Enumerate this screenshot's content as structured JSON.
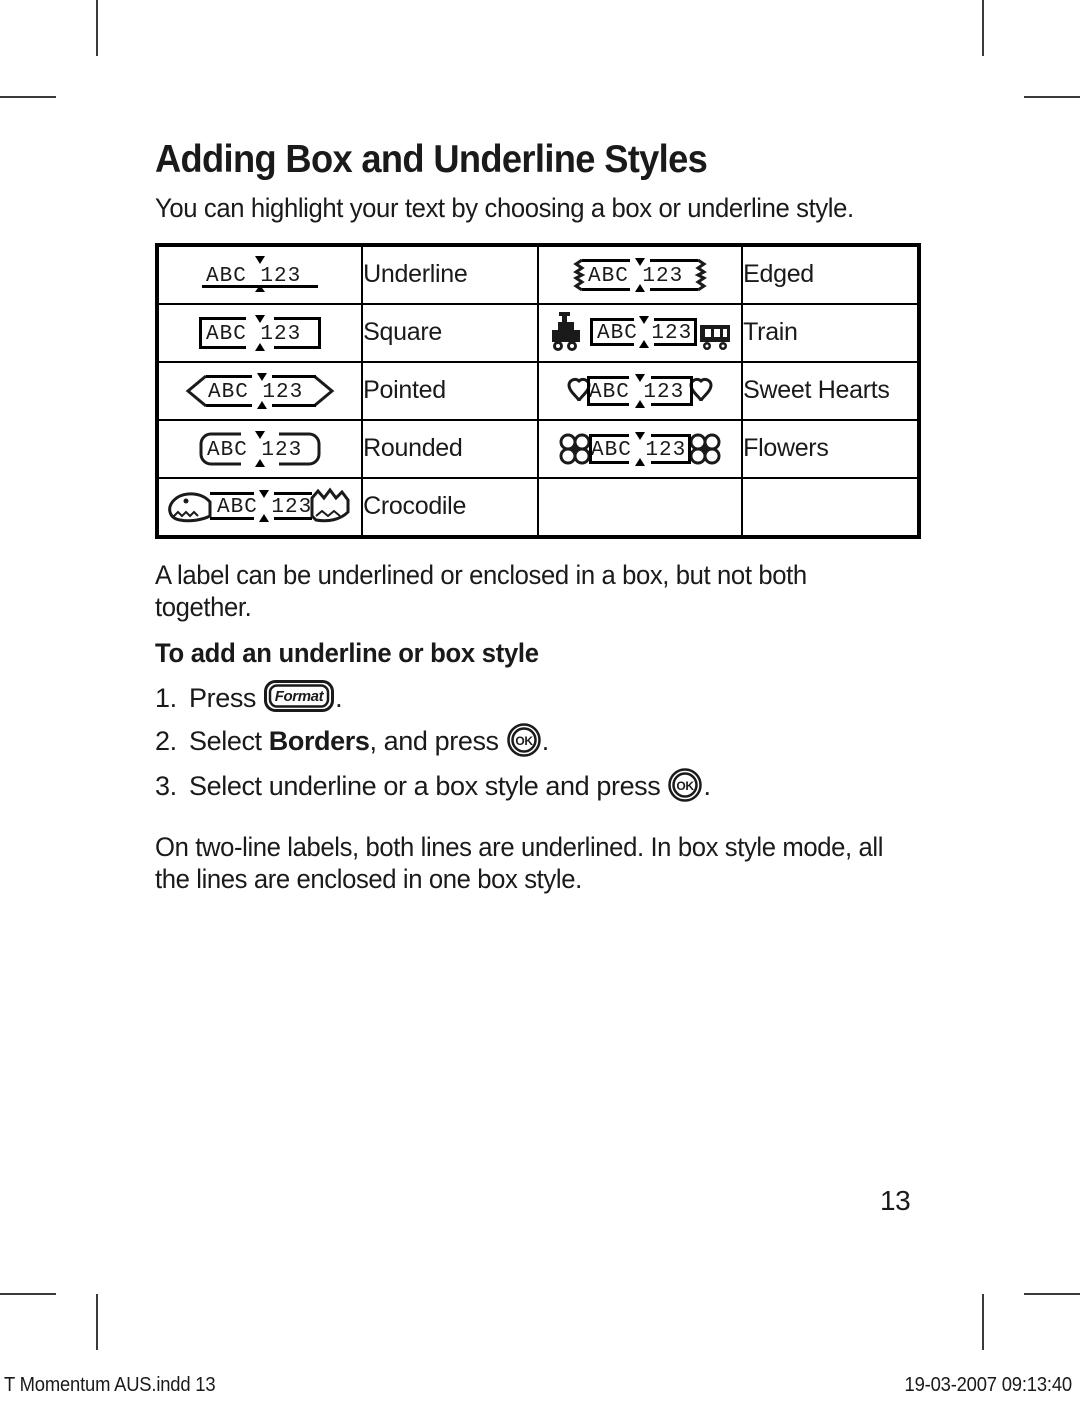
{
  "document": {
    "title": "Adding Box and Underline Styles",
    "lead": "You can highlight your text by choosing a box or underline style.",
    "note_both": "A label can be underlined or enclosed in a box, but not both together.",
    "subhead": "To add an underline or box style",
    "note_twoline": "On two-line labels, both lines are underlined. In box style mode, all the lines are enclosed in one box style.",
    "page_number": "13"
  },
  "sample_text": "ABC 123",
  "styles_table": {
    "rows": [
      {
        "left_style": "underline",
        "left_label": "Underline",
        "right_style": "edged",
        "right_label": "Edged"
      },
      {
        "left_style": "square",
        "left_label": "Square",
        "right_style": "train",
        "right_label": "Train"
      },
      {
        "left_style": "pointed",
        "left_label": "Pointed",
        "right_style": "sweet-hearts",
        "right_label": "Sweet Hearts"
      },
      {
        "left_style": "rounded",
        "left_label": "Rounded",
        "right_style": "flowers",
        "right_label": "Flowers"
      },
      {
        "left_style": "crocodile",
        "left_label": "Crocodile",
        "right_style": "",
        "right_label": ""
      }
    ]
  },
  "steps": [
    {
      "num": "1.",
      "before": "Press ",
      "key": "Format",
      "after": "."
    },
    {
      "num": "2.",
      "before": "Select ",
      "bold": "Borders",
      "mid": ", and press ",
      "key": "OK",
      "after": "."
    },
    {
      "num": "3.",
      "before": "Select underline or a box style and press ",
      "key": "OK",
      "after": "."
    }
  ],
  "keys": {
    "format_label": "Format",
    "ok_label": "OK"
  },
  "footer": {
    "left": "T  Momentum AUS.indd   13",
    "right": "19-03-2007   09:13:40"
  },
  "colors": {
    "ink": "#1a1a1a",
    "rule": "#000000",
    "crop_mark": "#3a3a3a"
  }
}
